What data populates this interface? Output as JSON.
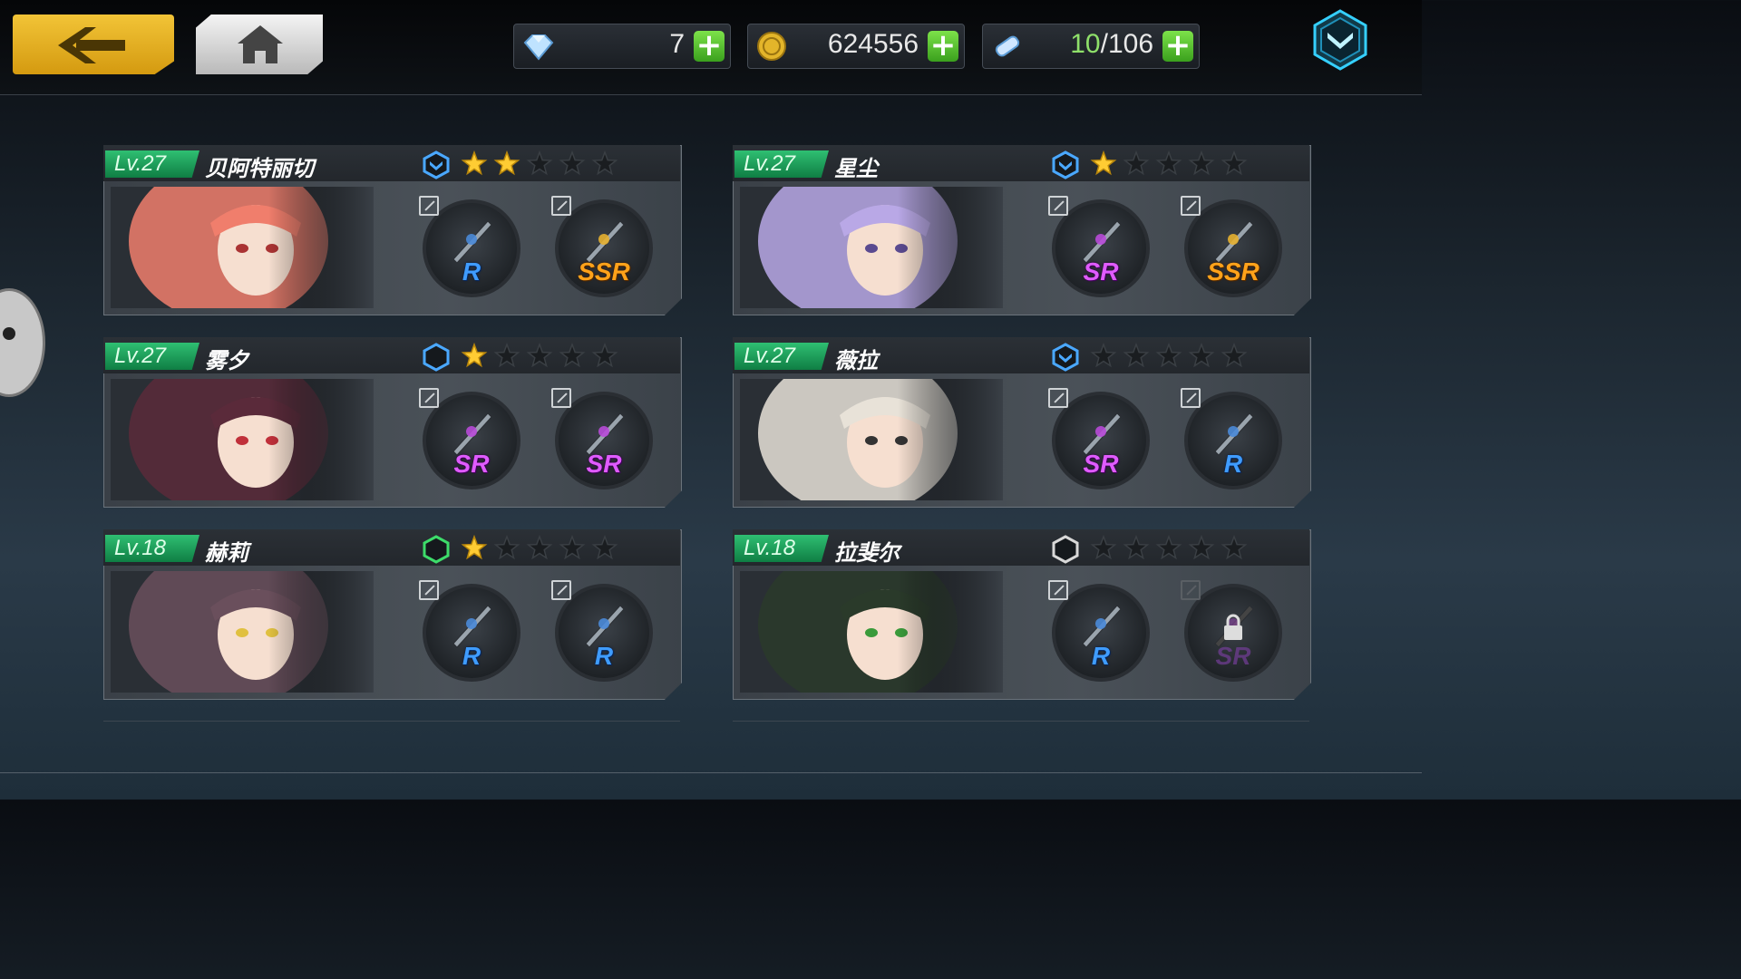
{
  "header": {
    "back_icon": "chevron-left-icon",
    "home_icon": "home-icon",
    "menu_icon": "chevron-down-shield-icon",
    "resources": [
      {
        "icon": "gem-icon",
        "value": "7",
        "highlight": "",
        "rest": ""
      },
      {
        "icon": "gold-coin-icon",
        "value": "624556",
        "highlight": "",
        "rest": ""
      },
      {
        "icon": "ticket-icon",
        "value": "",
        "highlight": "10",
        "rest": "/106"
      }
    ],
    "plus_label": "+"
  },
  "characters": [
    {
      "level": "Lv.27",
      "name": "贝阿特丽切",
      "rank_color": "#4aa8ff",
      "rank_icon": "chevron-hex-icon",
      "stars": 2,
      "weapons": [
        {
          "rarity": "R",
          "locked": false
        },
        {
          "rarity": "SSR",
          "locked": false
        }
      ]
    },
    {
      "level": "Lv.27",
      "name": "星尘",
      "rank_color": "#4aa8ff",
      "rank_icon": "chevron-hex-icon",
      "stars": 1,
      "weapons": [
        {
          "rarity": "SR",
          "locked": false
        },
        {
          "rarity": "SSR",
          "locked": false
        }
      ]
    },
    {
      "level": "Lv.27",
      "name": "雾夕",
      "rank_color": "#4aa8ff",
      "rank_icon": "hex-icon",
      "stars": 1,
      "weapons": [
        {
          "rarity": "SR",
          "locked": false
        },
        {
          "rarity": "SR",
          "locked": false
        }
      ]
    },
    {
      "level": "Lv.27",
      "name": "薇拉",
      "rank_color": "#4aa8ff",
      "rank_icon": "chevron-hex-icon",
      "stars": 0,
      "weapons": [
        {
          "rarity": "SR",
          "locked": false
        },
        {
          "rarity": "R",
          "locked": false
        }
      ]
    },
    {
      "level": "Lv.18",
      "name": "赫莉",
      "rank_color": "#3ddc6a",
      "rank_icon": "hex-icon",
      "stars": 1,
      "weapons": [
        {
          "rarity": "R",
          "locked": false
        },
        {
          "rarity": "R",
          "locked": false
        }
      ]
    },
    {
      "level": "Lv.18",
      "name": "拉斐尔",
      "rank_color": "#d8d8d8",
      "rank_icon": "hex-icon",
      "stars": 0,
      "weapons": [
        {
          "rarity": "R",
          "locked": false
        },
        {
          "rarity": "SR",
          "locked": true
        }
      ]
    }
  ],
  "max_stars": 5,
  "colors": {
    "accent": "#f2c437",
    "level_green": "#1f9e58",
    "star_gold": "#ffcc33",
    "star_empty": "#1a1d20"
  }
}
